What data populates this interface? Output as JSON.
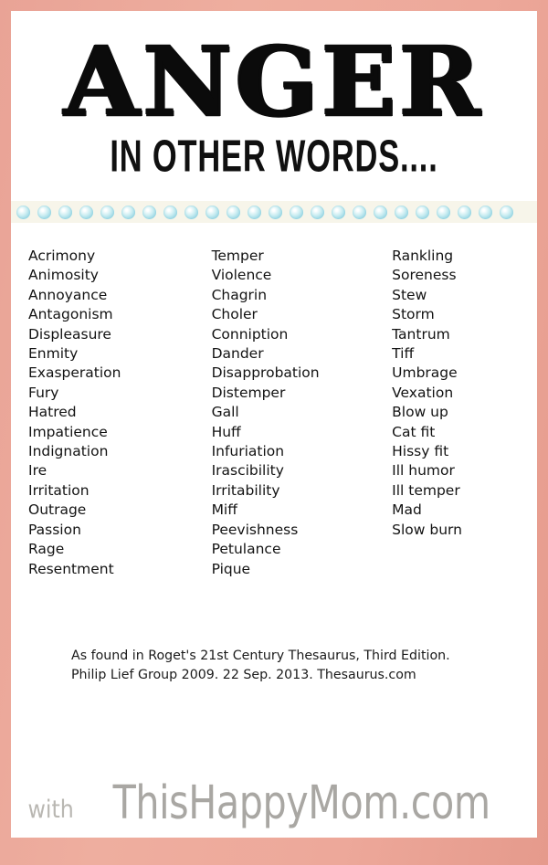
{
  "poster": {
    "border_color": "#eaa497",
    "background_color": "#ffffff",
    "title": "ANGER",
    "subtitle": "IN OTHER WORDS...."
  },
  "divider": {
    "band_color": "#f7f5ea",
    "dot_color": "#9fd9e6",
    "dot_count": 24
  },
  "word_columns": [
    {
      "column": 1,
      "words": [
        "Acrimony",
        "Animosity",
        "Annoyance",
        "Antagonism",
        "Displeasure",
        "Enmity",
        "Exasperation",
        "Fury",
        "Hatred",
        "Impatience",
        "Indignation",
        "Ire",
        "Irritation",
        "Outrage",
        "Passion",
        "Rage",
        "Resentment"
      ]
    },
    {
      "column": 2,
      "words": [
        "Temper",
        "Violence",
        "Chagrin",
        "Choler",
        "Conniption",
        "Dander",
        "Disapprobation",
        "Distemper",
        "Gall",
        "Huff",
        "Infuriation",
        "Irascibility",
        "Irritability",
        "Miff",
        "Peevishness",
        "Petulance",
        "Pique"
      ]
    },
    {
      "column": 3,
      "words": [
        "Rankling",
        "Soreness",
        "Stew",
        "Storm",
        "Tantrum",
        "Tiff",
        "Umbrage",
        "Vexation",
        "Blow up",
        "Cat fit",
        "Hissy fit",
        "Ill humor",
        "Ill temper",
        "Mad",
        "Slow burn"
      ]
    }
  ],
  "attribution": {
    "text": "As found in Roget's 21st Century Thesaurus, Third Edition. Philip Lief Group 2009. 22 Sep. 2013. Thesaurus.com"
  },
  "footer": {
    "prefix": "with",
    "brand": "ThisHappyMom.com",
    "text_color": "#aba9a5"
  }
}
